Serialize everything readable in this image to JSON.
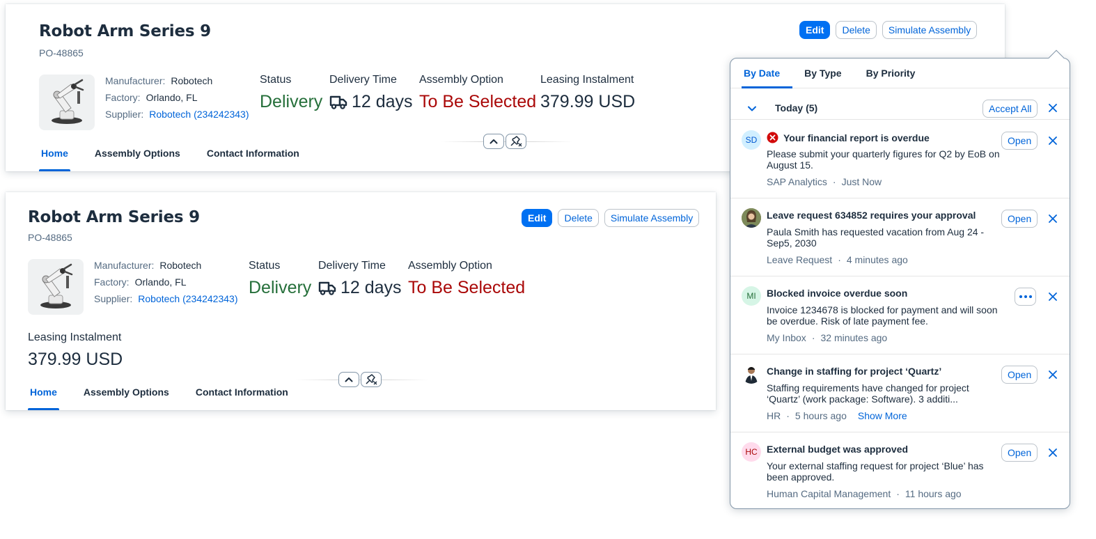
{
  "header_card_full": {
    "title": "Robot Arm Series 9",
    "subtitle": "PO-48865",
    "actions": {
      "edit": "Edit",
      "delete": "Delete",
      "simulate": "Simulate Assembly"
    },
    "attributes": {
      "manufacturer_label": "Manufacturer:",
      "manufacturer_value": "Robotech",
      "factory_label": "Factory:",
      "factory_value": "Orlando, FL",
      "supplier_label": "Supplier:",
      "supplier_value": "Robotech (234242343)"
    },
    "kpis": {
      "status_label": "Status",
      "status_value": "Delivery",
      "delivery_label": "Delivery Time",
      "delivery_value": "12 days",
      "assembly_label": "Assembly Option",
      "assembly_value": "To Be Selected",
      "leasing_label": "Leasing Instalment",
      "leasing_value": "379.99 USD"
    },
    "tabs": [
      "Home",
      "Assembly Options",
      "Contact Information"
    ],
    "active_tab": "Home"
  },
  "header_card_compact": {
    "title": "Robot Arm Series 9",
    "subtitle": "PO-48865",
    "actions": {
      "edit": "Edit",
      "delete": "Delete",
      "simulate": "Simulate Assembly"
    },
    "attributes": {
      "manufacturer_label": "Manufacturer:",
      "manufacturer_value": "Robotech",
      "factory_label": "Factory:",
      "factory_value": "Orlando, FL",
      "supplier_label": "Supplier:",
      "supplier_value": "Robotech (234242343)"
    },
    "kpis": {
      "status_label": "Status",
      "status_value": "Delivery",
      "delivery_label": "Delivery Time",
      "delivery_value": "12 days",
      "assembly_label": "Assembly Option",
      "assembly_value": "To Be Selected",
      "leasing_label": "Leasing Instalment",
      "leasing_value": "379.99 USD"
    },
    "tabs": [
      "Home",
      "Assembly Options",
      "Contact Information"
    ],
    "active_tab": "Home"
  },
  "notifications": {
    "tabs": [
      "By Date",
      "By Type",
      "By Priority"
    ],
    "active_tab": "By Date",
    "group": {
      "title": "Today (5)",
      "accept_all": "Accept All"
    },
    "items": [
      {
        "avatar": "SD",
        "title": "Your financial report is overdue",
        "has_error_icon": true,
        "description": "Please submit your quarterly figures for Q2 by EoB on August 15.",
        "source": "SAP Analytics",
        "time": "Just Now",
        "action": "Open"
      },
      {
        "avatar": "photo",
        "title": "Leave request 634852 requires your approval",
        "description": "Paula Smith has requested vacation from Aug 24 - Sep5, 2030",
        "source": "Leave Request",
        "time": "4 minutes ago",
        "action": "Open"
      },
      {
        "avatar": "MI",
        "title": "Blocked invoice overdue soon",
        "description": "Invoice 1234678 is blocked for payment and will soon be overdue. Risk of late payment fee.",
        "source": "My Inbox",
        "time": "32 minutes ago",
        "action": "more"
      },
      {
        "avatar": "photo",
        "title": "Change in staffing for project ‘Quartz’",
        "description": "Staffing requirements have changed for project ‘Quartz’ (work package: Software). 3 additi...",
        "source": "HR",
        "time": "5 hours ago",
        "show_more": "Show More",
        "action": "Open"
      },
      {
        "avatar": "HC",
        "title": "External budget was approved",
        "description": "Your external staffing request for project ‘Blue’ has been approved.",
        "source": "Human Capital Management",
        "time": "11 hours ago",
        "action": "Open"
      }
    ]
  },
  "colors": {
    "brand_blue": "#0070f2",
    "link_blue": "#0064d9",
    "positive": "#256f3a",
    "negative": "#aa0808",
    "text": "#1d2d3e",
    "secondary_text": "#556b82"
  }
}
